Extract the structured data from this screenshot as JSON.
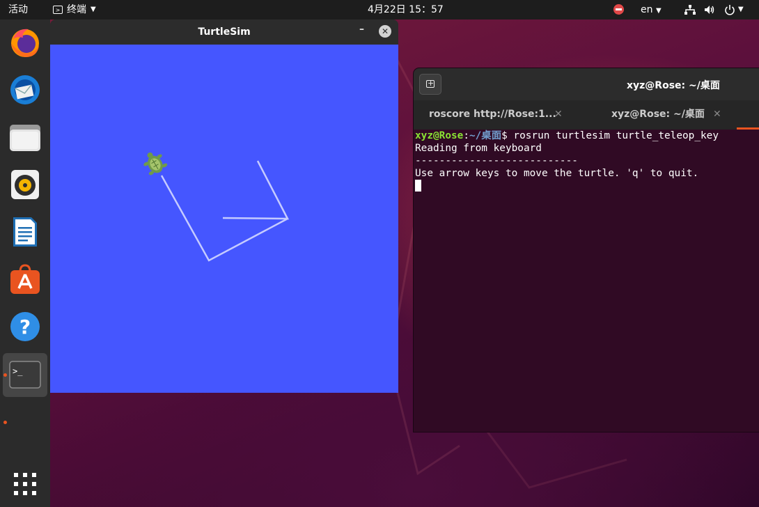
{
  "topbar": {
    "activities": "活动",
    "app_name": "终端",
    "clock": "4月22日 15：57",
    "lang": "en",
    "icons": [
      "terminal-icon",
      "do-not-disturb-icon",
      "network-icon",
      "volume-icon",
      "power-icon"
    ]
  },
  "dock": {
    "items": [
      {
        "name": "firefox",
        "icon": "firefox-icon"
      },
      {
        "name": "thunderbird",
        "icon": "thunderbird-icon"
      },
      {
        "name": "files",
        "icon": "files-icon"
      },
      {
        "name": "rhythmbox",
        "icon": "rhythmbox-icon"
      },
      {
        "name": "libreoffice-writer",
        "icon": "writer-icon"
      },
      {
        "name": "ubuntu-software",
        "icon": "software-icon"
      },
      {
        "name": "help",
        "icon": "help-icon"
      },
      {
        "name": "terminal",
        "icon": "terminal-icon",
        "active": true
      }
    ],
    "show_apps_icon": "grid-icon"
  },
  "turtlesim": {
    "title": "TurtleSim",
    "minimize": "–",
    "close": "✕",
    "background_color": "#4556ff",
    "path_color": "#c5cbff"
  },
  "terminal": {
    "title": "xyz@Rose: ~/桌面",
    "tabs": [
      {
        "label": "roscore http://Rose:1...",
        "active": false
      },
      {
        "label": "xyz@Rose: ~/桌面",
        "active": true
      }
    ],
    "tab_close": "✕",
    "prompt_user": "xyz@Rose",
    "prompt_sep": ":",
    "prompt_path": "~/桌面",
    "prompt_end": "$ ",
    "command": "rosrun turtlesim turtle_teleop_key",
    "output": [
      "Reading from keyboard",
      "---------------------------",
      "Use arrow keys to move the turtle. 'q' to quit."
    ]
  },
  "colors": {
    "accent": "#e95420",
    "terminal_bg": "#300a24",
    "prompt_green": "#8ae234",
    "prompt_blue": "#729fcf"
  }
}
